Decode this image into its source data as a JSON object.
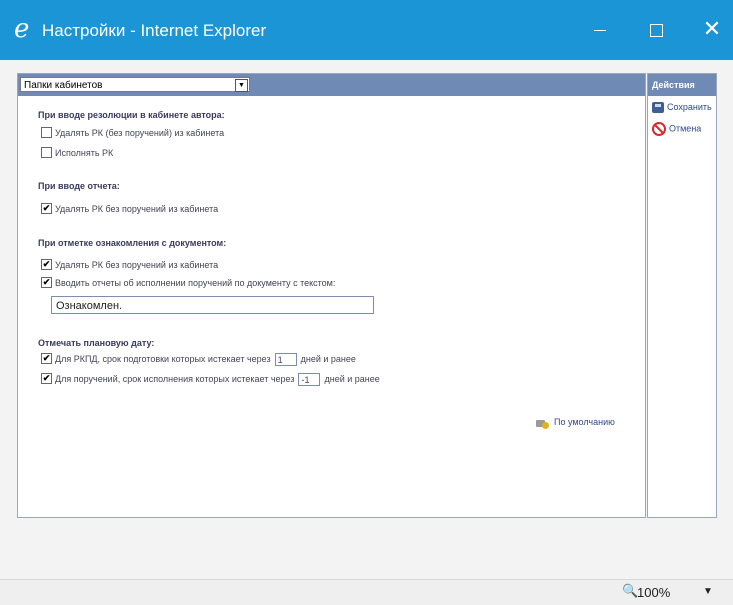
{
  "window": {
    "title": "Настройки - Internet Explorer",
    "app_icon": "ie-icon",
    "minimize": "—",
    "close": "✕"
  },
  "toolbar": {
    "folder_select_value": "Папки кабинетов",
    "folder_select_arrow": "▼"
  },
  "sections": {
    "resolution_title": "При вводе резолюции в кабинете автора:",
    "resolution_delete_label": "Удалять РК (без поручений) из кабинета",
    "resolution_delete_checked": false,
    "resolution_execute_label": "Исполнять РК",
    "resolution_execute_checked": false,
    "report_title": "При вводе отчета:",
    "report_delete_label": "Удалять РК без поручений из кабинета",
    "report_delete_checked": true,
    "acquaint_title": "При отметке ознакомления с документом:",
    "acquaint_delete_label": "Удалять РК без поручений из кабинета",
    "acquaint_delete_checked": true,
    "acquaint_report_label": "Вводить отчеты об исполнении поручений по документу с текстом:",
    "acquaint_report_checked": true,
    "acquaint_text_value": "Ознакомлен.",
    "plan_title": "Отмечать плановую дату:",
    "plan_rkpd_label": "Для РКПД, срок подготовки которых истекает через",
    "plan_rkpd_value": "1",
    "plan_rkpd_suffix": "дней и ранее",
    "plan_rkpd_checked": true,
    "plan_orders_label": "Для поручений, срок исполнения которых истекает через",
    "plan_orders_value": "-1",
    "plan_orders_suffix": "дней и ранее",
    "plan_orders_checked": true
  },
  "default_button": "По умолчанию",
  "actions": {
    "header": "Действия",
    "save_label": "Сохранить",
    "cancel_label": "Отмена"
  },
  "status": {
    "zoom": "100%",
    "zoom_arrow": "▼"
  },
  "check_mark": "✔"
}
